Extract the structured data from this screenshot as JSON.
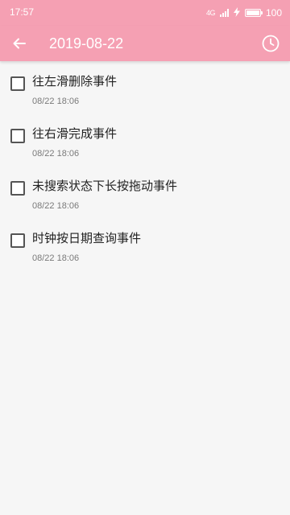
{
  "status_bar": {
    "time": "17:57",
    "signal_text": "4G",
    "battery_level": "100",
    "icons": [
      "signal-icon",
      "charging-icon",
      "battery-icon"
    ]
  },
  "app_bar": {
    "title": "2019-08-22",
    "back_icon": "arrow-left-icon",
    "clock_icon": "clock-icon",
    "color": "#f5a0b3"
  },
  "tasks": [
    {
      "title": "往左滑删除事件",
      "date": "08/22 18:06",
      "checked": false
    },
    {
      "title": "往右滑完成事件",
      "date": "08/22 18:06",
      "checked": false
    },
    {
      "title": "未搜索状态下长按拖动事件",
      "date": "08/22 18:06",
      "checked": false
    },
    {
      "title": "时钟按日期查询事件",
      "date": "08/22 18:06",
      "checked": false
    }
  ]
}
